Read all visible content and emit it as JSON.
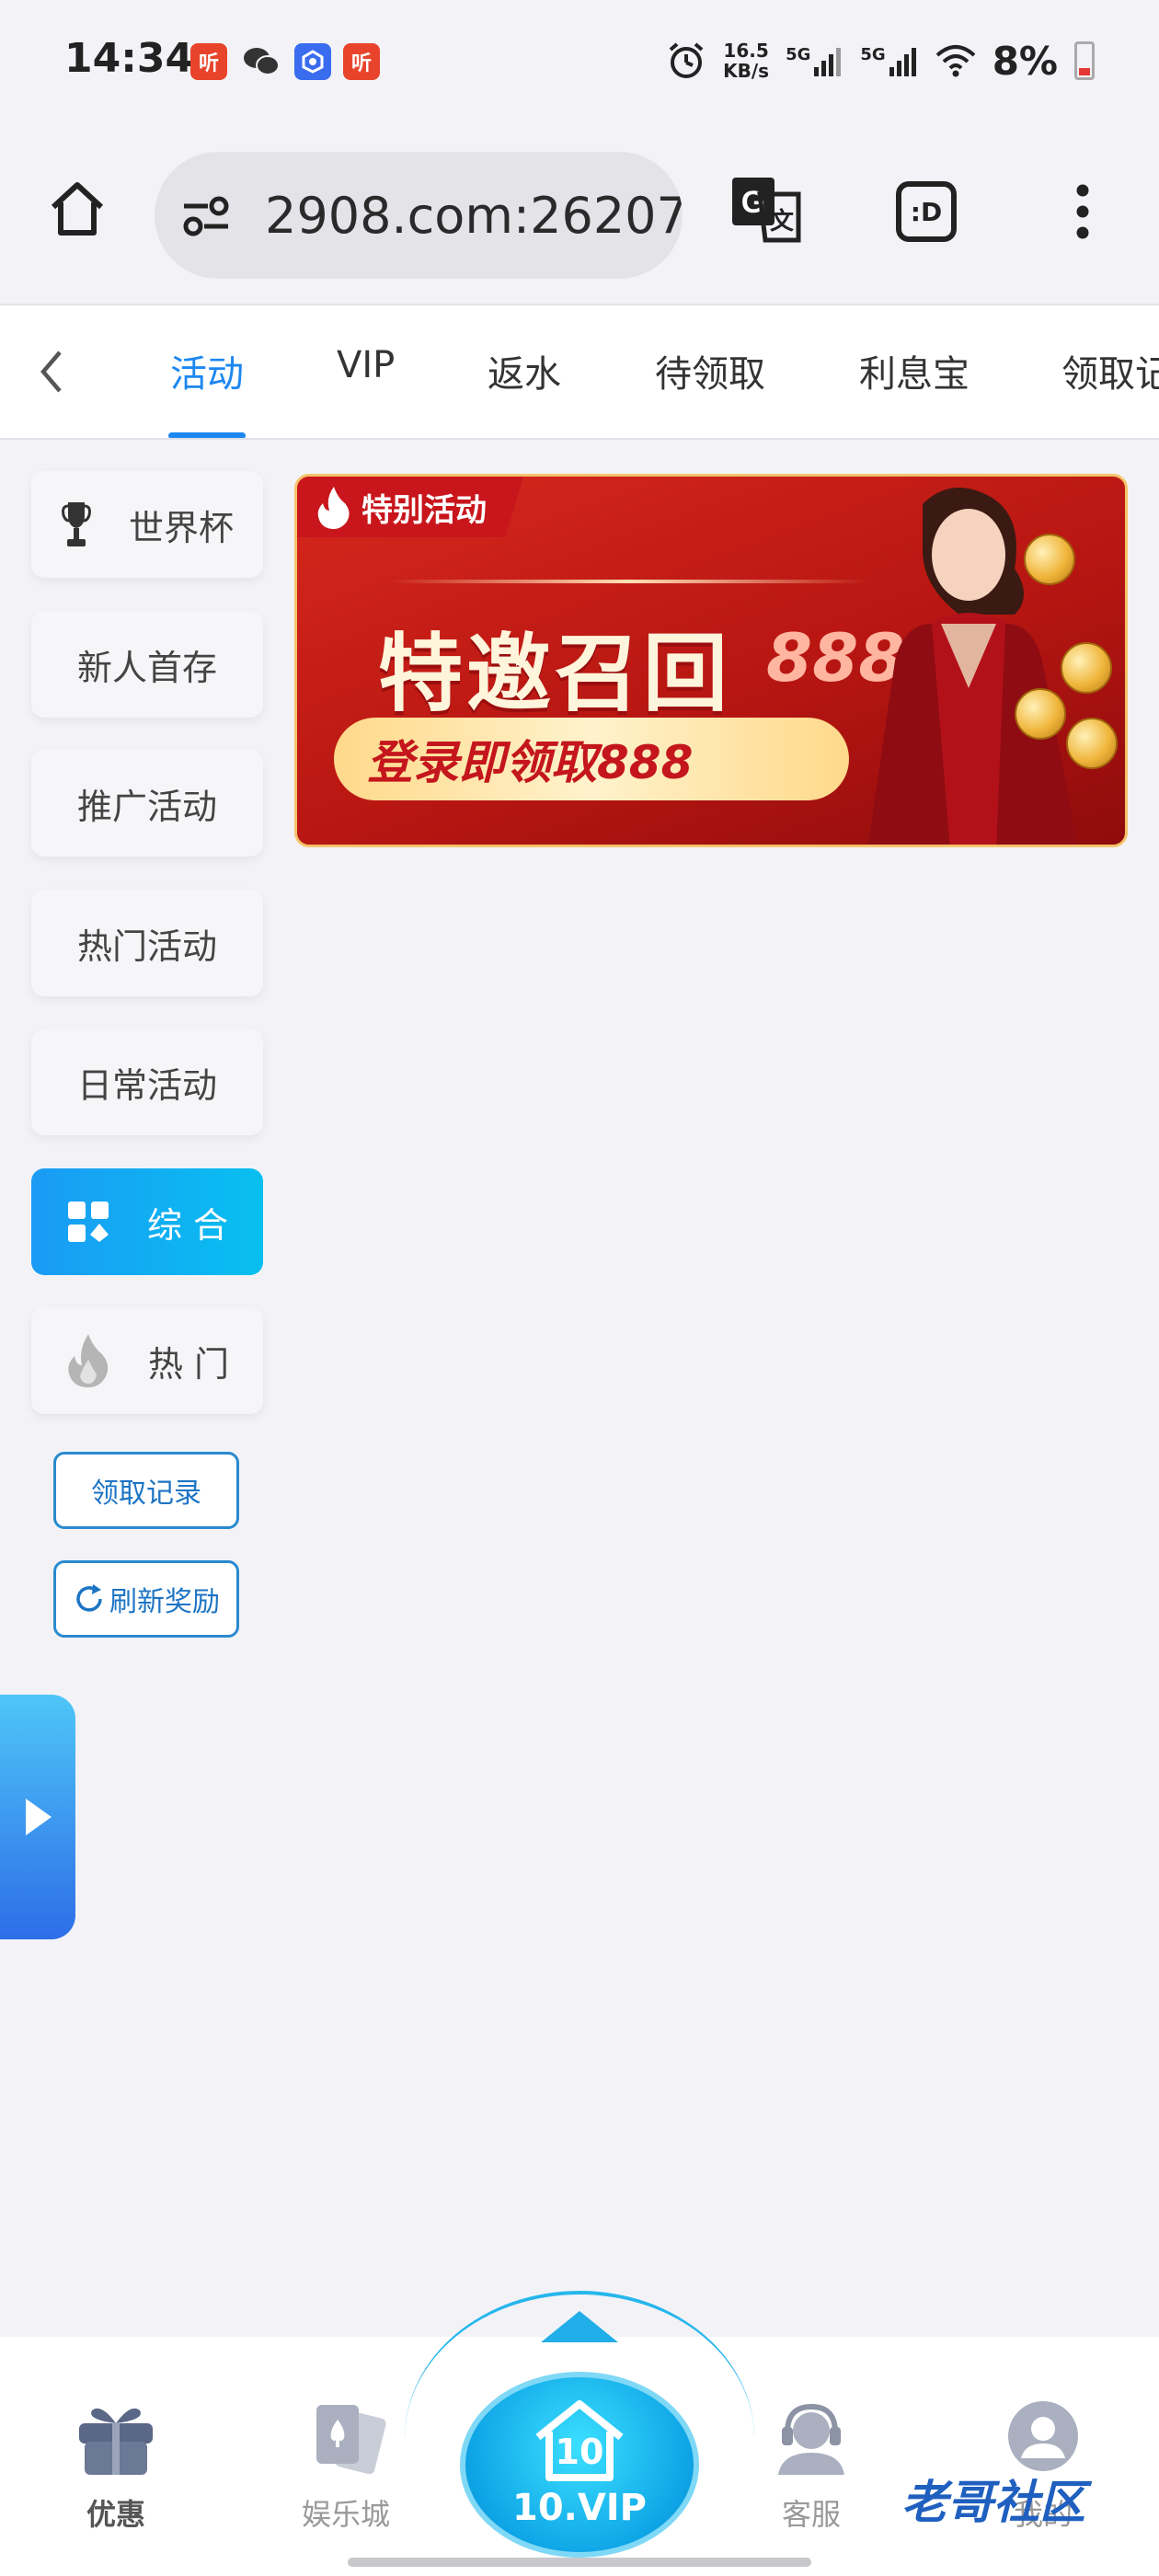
{
  "status_bar": {
    "time": "14:34",
    "app_badges": [
      {
        "icon": "ting-app-icon",
        "text": "听",
        "color": "#e8442c"
      },
      {
        "icon": "wechat-icon",
        "text": "",
        "color": "#333333"
      },
      {
        "icon": "camera-app-icon",
        "text": "",
        "color": "#3a6cf0"
      },
      {
        "icon": "ting-app-icon",
        "text": "听",
        "color": "#e8442c"
      }
    ],
    "net_speed_value": "16.5",
    "net_speed_unit": "KB/s",
    "signal_1": "5G",
    "signal_2": "5G",
    "battery": "8%"
  },
  "browser": {
    "url": "2908.com:26207",
    "buttons": [
      "home-icon",
      "site-settings-icon",
      "translate-icon",
      "tab-switcher-icon",
      "more-icon"
    ],
    "tab_switcher_label": ":D"
  },
  "tabs": {
    "back_icon": "chevron-left-icon",
    "items": [
      {
        "label": "活动",
        "active": true
      },
      {
        "label": "VIP"
      },
      {
        "label": "返水"
      },
      {
        "label": "待领取"
      },
      {
        "label": "利息宝"
      },
      {
        "label": "领取记"
      }
    ]
  },
  "sidebar": {
    "items": [
      {
        "label": "世界杯",
        "icon": "trophy-icon"
      },
      {
        "label": "新人首存"
      },
      {
        "label": "推广活动"
      },
      {
        "label": "热门活动"
      },
      {
        "label": "日常活动"
      },
      {
        "label": "综 合",
        "icon": "grid-icon",
        "active": true
      },
      {
        "label": "热 门",
        "icon": "fire-icon"
      }
    ],
    "records_button": "领取记录",
    "refresh_button": "刷新奖励"
  },
  "banner": {
    "tag": "特别活动",
    "title": "特邀召回",
    "subtitle": "登录即领取888",
    "badge": "888",
    "accent": "#c8161c"
  },
  "bottom_nav": {
    "items": [
      {
        "label": "优惠",
        "icon": "gift-icon",
        "active": true
      },
      {
        "label": "娱乐城",
        "icon": "cards-icon"
      },
      {
        "label": "10.VIP",
        "icon": "vip-home-icon",
        "badge": "10"
      },
      {
        "label": "客服",
        "icon": "support-icon"
      },
      {
        "label": "我的",
        "icon": "user-icon"
      }
    ],
    "watermark": "老哥社区"
  }
}
